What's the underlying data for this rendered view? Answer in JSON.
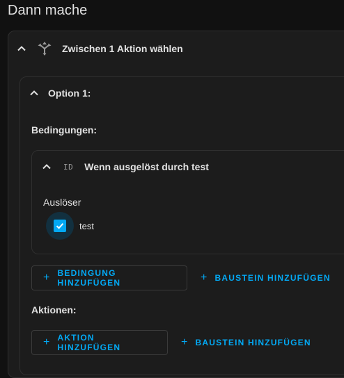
{
  "page": {
    "title": "Dann mache"
  },
  "choose_action": {
    "title": "Zwischen 1 Aktion wählen",
    "expand_icon": "chevron-up-icon",
    "type_icon": "arrow-decision-icon"
  },
  "option": {
    "title": "Option 1:",
    "conditions_label": "Bedingungen:",
    "actions_label": "Aktionen:"
  },
  "condition": {
    "icon_text": "ID",
    "title": "Wenn ausgelöst durch test",
    "trigger_label": "Auslöser",
    "trigger_option": "test",
    "checked": true
  },
  "buttons": {
    "add_condition": "Bedingung hinzufügen",
    "add_building_block_1": "Baustein hinzufügen",
    "add_action": "Aktion hinzufügen",
    "add_building_block_2": "Baustein hinzufügen",
    "plus_symbol": "+"
  },
  "colors": {
    "accent": "#03a9f4",
    "background": "#111111",
    "card": "#1c1c1c",
    "text": "#e1e1e1"
  }
}
